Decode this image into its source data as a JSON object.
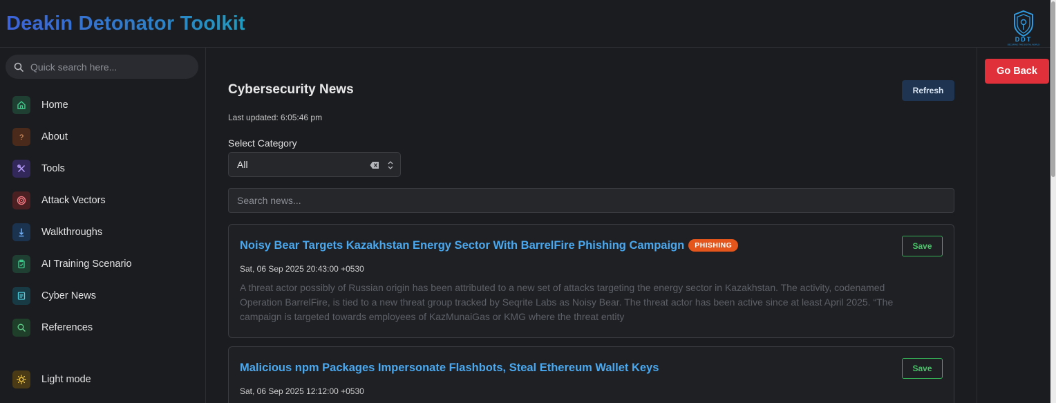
{
  "header": {
    "title": "Deakin Detonator Toolkit",
    "logo_text": "DDT",
    "logo_tagline": "SECURING THE DIGITAL WORLD"
  },
  "sidebar": {
    "search_placeholder": "Quick search here...",
    "items": [
      {
        "label": "Home",
        "icon": "home-icon",
        "color": "#1f3f33",
        "fg": "#3ecf8e"
      },
      {
        "label": "About",
        "icon": "question-icon",
        "color": "#4a2a1a",
        "fg": "#f0a36a"
      },
      {
        "label": "Tools",
        "icon": "tools-icon",
        "color": "#33285a",
        "fg": "#b79cff"
      },
      {
        "label": "Attack Vectors",
        "icon": "target-icon",
        "color": "#4a2023",
        "fg": "#ff7f88"
      },
      {
        "label": "Walkthroughs",
        "icon": "arrow-down-icon",
        "color": "#1c3350",
        "fg": "#73b4ff"
      },
      {
        "label": "AI Training Scenario",
        "icon": "clipboard-icon",
        "color": "#1f3f33",
        "fg": "#3ecf8e"
      },
      {
        "label": "Cyber News",
        "icon": "news-icon",
        "color": "#183a45",
        "fg": "#4fd1e0"
      },
      {
        "label": "References",
        "icon": "search-icon",
        "color": "#1f3f2a",
        "fg": "#5fd08a"
      }
    ],
    "theme_toggle": {
      "label": "Light mode",
      "icon": "sun-icon",
      "color": "#4a3a15",
      "fg": "#ffd24a"
    }
  },
  "actions": {
    "go_back": "Go Back"
  },
  "news": {
    "title": "Cybersecurity News",
    "refresh_label": "Refresh",
    "last_updated": "Last updated: 6:05:46 pm",
    "category_label": "Select Category",
    "category_value": "All",
    "search_placeholder": "Search news...",
    "articles": [
      {
        "title": "Noisy Bear Targets Kazakhstan Energy Sector With BarrelFire Phishing Campaign",
        "badge": "PHISHING",
        "date": "Sat, 06 Sep 2025 20:43:00 +0530",
        "description": "A threat actor possibly of Russian origin has been attributed to a new set of attacks targeting the energy sector in Kazakhstan. The activity, codenamed Operation BarrelFire, is tied to a new threat group tracked by Seqrite Labs as Noisy Bear. The threat actor has been active since at least April 2025. “The campaign is targeted towards employees of KazMunaiGas or KMG where the threat entity",
        "save_label": "Save"
      },
      {
        "title": "Malicious npm Packages Impersonate Flashbots, Steal Ethereum Wallet Keys",
        "date": "Sat, 06 Sep 2025 12:12:00 +0530",
        "save_label": "Save"
      }
    ]
  },
  "colors": {
    "background": "#1b1c20",
    "link": "#4aa8ef",
    "badge": "#e4561b",
    "go_back": "#e0303a",
    "save_border": "#35b356",
    "refresh_bg": "#1e3450"
  }
}
